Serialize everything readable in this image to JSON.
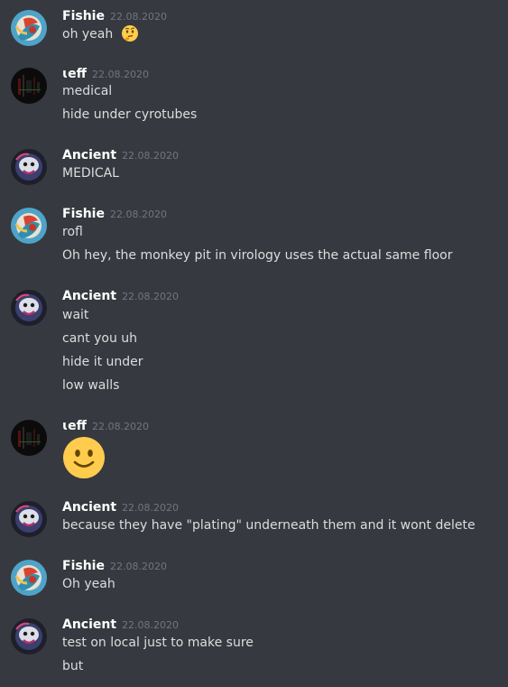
{
  "messages": [
    {
      "author": "Fishie",
      "timestamp": "22.08.2020",
      "avatar": "fishie-avatar",
      "lines": [
        "oh yeah"
      ],
      "emoji": "thinking-face"
    },
    {
      "author": "ɩeff",
      "timestamp": "22.08.2020",
      "avatar": "jeff-avatar",
      "lines": [
        "medical",
        "hide under cyrotubes"
      ]
    },
    {
      "author": "Ancient",
      "timestamp": "22.08.2020",
      "avatar": "ancient-avatar",
      "lines": [
        "MEDICAL"
      ]
    },
    {
      "author": "Fishie",
      "timestamp": "22.08.2020",
      "avatar": "fishie-avatar",
      "lines": [
        "rofl",
        "Oh hey, the monkey pit in virology uses the actual same floor"
      ]
    },
    {
      "author": "Ancient",
      "timestamp": "22.08.2020",
      "avatar": "ancient-avatar",
      "lines": [
        "wait",
        "cant you uh",
        "hide it under",
        "low walls"
      ]
    },
    {
      "author": "ɩeff",
      "timestamp": "22.08.2020",
      "avatar": "jeff-avatar",
      "lines": [],
      "emoji": "slightly-smiling-face"
    },
    {
      "author": "Ancient",
      "timestamp": "22.08.2020",
      "avatar": "ancient-avatar",
      "lines": [
        "because they have \"plating\" underneath them and it wont delete"
      ]
    },
    {
      "author": "Fishie",
      "timestamp": "22.08.2020",
      "avatar": "fishie-avatar",
      "lines": [
        "Oh yeah"
      ]
    },
    {
      "author": "Ancient",
      "timestamp": "22.08.2020",
      "avatar": "ancient-avatar",
      "lines": [
        "test on local just to make sure",
        "but"
      ]
    }
  ],
  "colors": {
    "background": "#36393f",
    "username": "#ffffff",
    "timestamp": "#72767d",
    "text": "#dcddde",
    "emoji_yellow": "#ffcc4d"
  }
}
